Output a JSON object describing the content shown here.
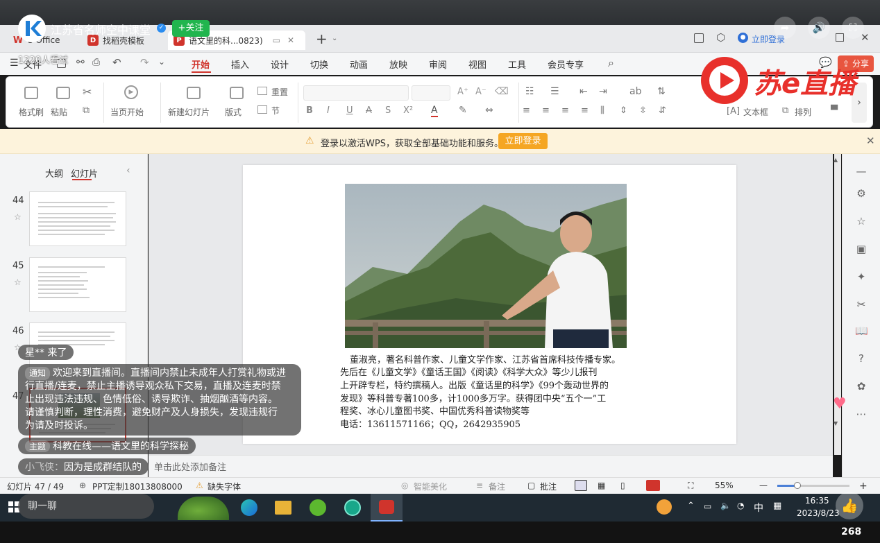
{
  "stream": {
    "channel_name": "江苏省名师空中课堂",
    "follow_label": "+关注",
    "viewers": "1220人看过",
    "brand_text": "苏e直播",
    "like_count": "268",
    "chat_input_placeholder": "聊一聊"
  },
  "tabs": [
    {
      "label": "S Office",
      "icon_text": "W",
      "color": "#d0342c"
    },
    {
      "label": "找稻壳模板",
      "icon_text": "D",
      "color": "#d0342c"
    },
    {
      "label": "语文里的科...0823)",
      "icon_text": "P",
      "color": "#d0342c"
    }
  ],
  "titlebar": {
    "login_label": "立即登录"
  },
  "menu": {
    "file": "文件",
    "items": [
      "开始",
      "插入",
      "设计",
      "切换",
      "动画",
      "放映",
      "审阅",
      "视图",
      "工具",
      "会员专享"
    ],
    "share": "分享"
  },
  "ribbon": {
    "format_painter": "格式刷",
    "paste": "粘贴",
    "from_current": "当页开始",
    "new_slide": "新建幻灯片",
    "layout": "版式",
    "reset": "重置",
    "section": "节",
    "text_box": "文本框",
    "arrange": "排列",
    "shape": "形状"
  },
  "notice": {
    "text": "登录以激活WPS，获取全部基础功能和服务。",
    "button": "立即登录"
  },
  "sidebar": {
    "tab_outline": "大纲",
    "tab_slides": "幻灯片",
    "thumbs": [
      {
        "num": "44"
      },
      {
        "num": "45"
      },
      {
        "num": "46"
      },
      {
        "num": "47"
      }
    ]
  },
  "slide": {
    "caption_lines": [
      "董淑亮，著名科普作家、儿童文学作家、江苏省首席科技传播专家。",
      "先后在《儿童文学》《童话王国》《阅读》《科学大众》等少儿报刊",
      "上开辟专栏，特约撰稿人。出版《童话里的科学》《99个轰动世界的",
      "发现》等科普专著100多，计1000多万字。获得团中央“五个一”工",
      "程奖、冰心儿童图书奖、中国优秀科普读物奖等",
      "电话：13611571166；QQ，2642935905"
    ]
  },
  "notes_placeholder": "单击此处添加备注",
  "status": {
    "slide_count": "幻灯片 47 / 49",
    "ppt_custom": "PPT定制18013808000",
    "missing_font": "缺失字体",
    "smart_beautify": "智能美化",
    "notes": "备注",
    "comment": "批注",
    "zoom": "55%"
  },
  "taskbar": {
    "ime": "中",
    "time": "16:35",
    "date": "2023/8/23"
  },
  "chat": {
    "join_msg": "星** 来了",
    "notice_tag": "通知",
    "notice_text": [
      "欢迎来到直播间。直播间内禁止未成年人打赏礼物或进",
      "行直播/连麦，禁止主播诱导观众私下交易，直播及连麦时禁",
      "止出现违法违规、色情低俗、诱导欺诈、抽烟酗酒等内容。",
      "请谨慎判断，理性消费，避免财产及人身损失，发现违规行",
      "为请及时投诉。"
    ],
    "topic_tag": "主题",
    "topic_text": "科教在线——语文里的科学探秘",
    "user_name": "小飞侠：",
    "user_msg": "因为是成群结队的"
  }
}
